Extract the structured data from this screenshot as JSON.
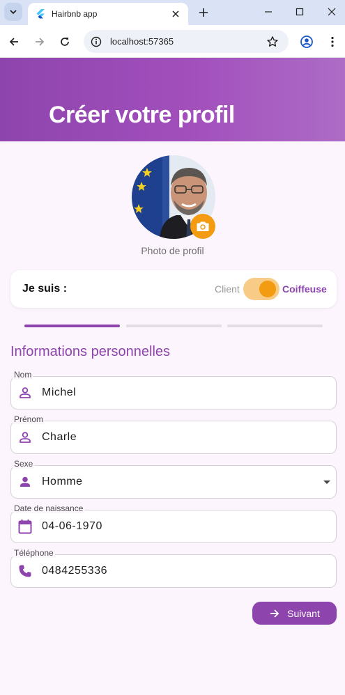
{
  "browser": {
    "tab_title": "Hairbnb app",
    "url": "localhost:57365"
  },
  "header": {
    "title": "Créer votre profil"
  },
  "profile": {
    "photo_label": "Photo de profil"
  },
  "role": {
    "label": "Je suis :",
    "option_left": "Client",
    "option_right": "Coiffeuse",
    "selected": "Coiffeuse"
  },
  "steps": {
    "current": 1,
    "total": 3
  },
  "section": {
    "title": "Informations personnelles"
  },
  "form": {
    "nom": {
      "label": "Nom",
      "value": "Michel"
    },
    "prenom": {
      "label": "Prénom",
      "value": "Charle"
    },
    "sexe": {
      "label": "Sexe",
      "value": "Homme"
    },
    "naissance": {
      "label": "Date de naissance",
      "value": "04-06-1970"
    },
    "telephone": {
      "label": "Téléphone",
      "value": "0484255336"
    }
  },
  "actions": {
    "next_label": "Suivant"
  },
  "colors": {
    "primary": "#8e44ad",
    "accent": "#f39c12"
  }
}
